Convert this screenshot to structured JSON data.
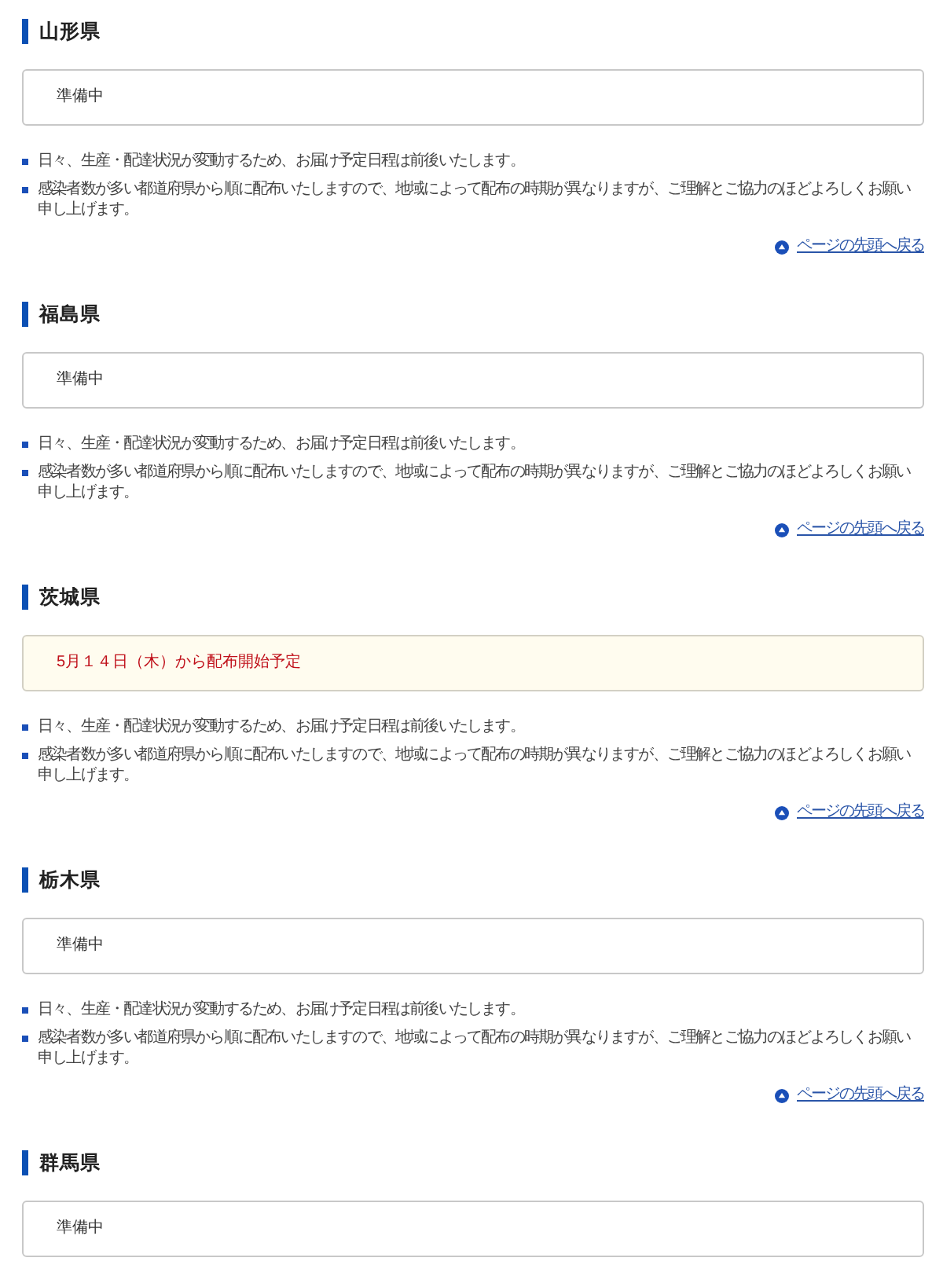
{
  "sections": [
    {
      "heading": "山形県",
      "status": {
        "kind": "plain",
        "text": "準備中"
      },
      "notes": [
        "日々、生産・配達状況が変動するため、お届け予定日程は前後いたします。",
        "感染者数が多い都道府県から順に配布いたしますので、地域によって配布の時期が異なりますが、ご理解とご協力のほどよろしくお願い申し上げます。"
      ],
      "back_to_top": "ページの先頭へ戻る"
    },
    {
      "heading": "福島県",
      "status": {
        "kind": "plain",
        "text": "準備中"
      },
      "notes": [
        "日々、生産・配達状況が変動するため、お届け予定日程は前後いたします。",
        "感染者数が多い都道府県から順に配布いたしますので、地域によって配布の時期が異なりますが、ご理解とご協力のほどよろしくお願い申し上げます。"
      ],
      "back_to_top": "ページの先頭へ戻る"
    },
    {
      "heading": "茨城県",
      "status": {
        "kind": "notice",
        "text": "5月１４日（木）から配布開始予定"
      },
      "notes": [
        "日々、生産・配達状況が変動するため、お届け予定日程は前後いたします。",
        "感染者数が多い都道府県から順に配布いたしますので、地域によって配布の時期が異なりますが、ご理解とご協力のほどよろしくお願い申し上げます。"
      ],
      "back_to_top": "ページの先頭へ戻る"
    },
    {
      "heading": "栃木県",
      "status": {
        "kind": "plain",
        "text": "準備中"
      },
      "notes": [
        "日々、生産・配達状況が変動するため、お届け予定日程は前後いたします。",
        "感染者数が多い都道府県から順に配布いたしますので、地域によって配布の時期が異なりますが、ご理解とご協力のほどよろしくお願い申し上げます。"
      ],
      "back_to_top": "ページの先頭へ戻る"
    },
    {
      "heading": "群馬県",
      "status": {
        "kind": "plain",
        "text": "準備中"
      }
    }
  ]
}
